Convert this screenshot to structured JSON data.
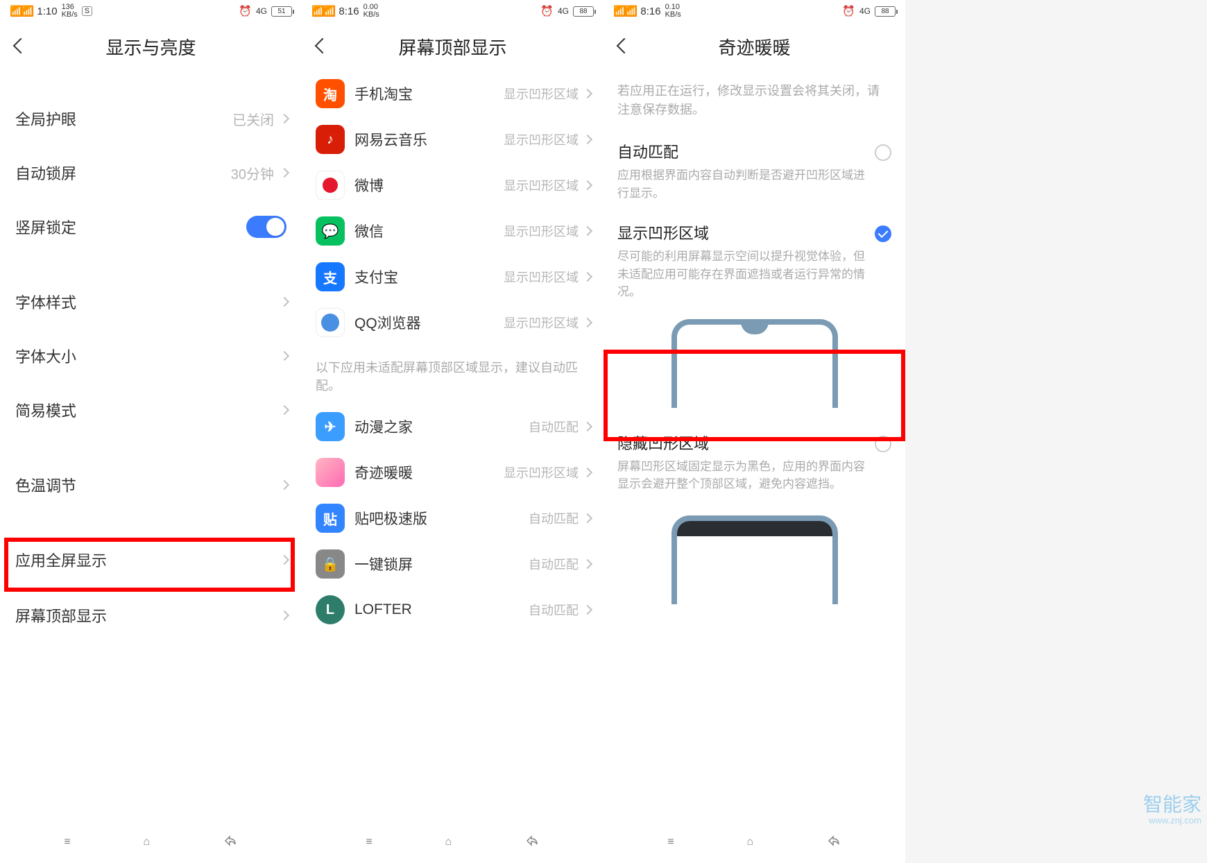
{
  "screen1": {
    "status": {
      "left": "1:10",
      "kbps": "136\nKB/s",
      "net": "4G",
      "battery": "51"
    },
    "title": "显示与亮度",
    "rows": [
      {
        "label": "全局护眼",
        "value": "已关闭",
        "type": "link"
      },
      {
        "label": "自动锁屏",
        "value": "30分钟",
        "type": "link"
      },
      {
        "label": "竖屏锁定",
        "type": "toggle",
        "on": true
      },
      {
        "label": "字体样式",
        "type": "link"
      },
      {
        "label": "字体大小",
        "type": "link"
      },
      {
        "label": "简易模式",
        "type": "link"
      },
      {
        "label": "色温调节",
        "type": "link"
      },
      {
        "label": "应用全屏显示",
        "type": "link"
      },
      {
        "label": "屏幕顶部显示",
        "type": "link",
        "highlighted": true
      }
    ]
  },
  "screen2": {
    "status": {
      "left": "8:16",
      "kbps": "0.00\nKB/s",
      "net": "4G",
      "battery": "88"
    },
    "title": "屏幕顶部显示",
    "apps_top": [
      {
        "name": "手机淘宝",
        "status": "显示凹形区域",
        "icon": "taobao"
      },
      {
        "name": "网易云音乐",
        "status": "显示凹形区域",
        "icon": "netease"
      },
      {
        "name": "微博",
        "status": "显示凹形区域",
        "icon": "weibo"
      },
      {
        "name": "微信",
        "status": "显示凹形区域",
        "icon": "wechat"
      },
      {
        "name": "支付宝",
        "status": "显示凹形区域",
        "icon": "alipay"
      },
      {
        "name": "QQ浏览器",
        "status": "显示凹形区域",
        "icon": "qqbrowser"
      }
    ],
    "section_hint": "以下应用未适配屏幕顶部区域显示，建议自动匹配。",
    "apps_bottom": [
      {
        "name": "动漫之家",
        "status": "自动匹配",
        "icon": "dmzj"
      },
      {
        "name": "奇迹暖暖",
        "status": "显示凹形区域",
        "icon": "nuan"
      },
      {
        "name": "贴吧极速版",
        "status": "自动匹配",
        "icon": "tieba"
      },
      {
        "name": "一键锁屏",
        "status": "自动匹配",
        "icon": "lock"
      },
      {
        "name": "LOFTER",
        "status": "自动匹配",
        "icon": "lofter"
      }
    ]
  },
  "screen3": {
    "status": {
      "left": "8:16",
      "kbps": "0.10\nKB/s",
      "net": "4G",
      "battery": "88"
    },
    "title": "奇迹暖暖",
    "top_hint": "若应用正在运行，修改显示设置会将其关闭，请注意保存数据。",
    "options": [
      {
        "title": "自动匹配",
        "desc": "应用根据界面内容自动判断是否避开凹形区域进行显示。",
        "checked": false
      },
      {
        "title": "显示凹形区域",
        "desc": "尽可能的利用屏幕显示空间以提升视觉体验，但未适配应用可能存在界面遮挡或者运行异常的情况。",
        "checked": true
      },
      {
        "title": "隐藏凹形区域",
        "desc": "屏幕凹形区域固定显示为黑色，应用的界面内容显示会避开整个顶部区域，避免内容遮挡。",
        "checked": false,
        "highlighted": true
      }
    ]
  },
  "watermark": {
    "main": "智能家",
    "sub": "www.znj.com"
  }
}
